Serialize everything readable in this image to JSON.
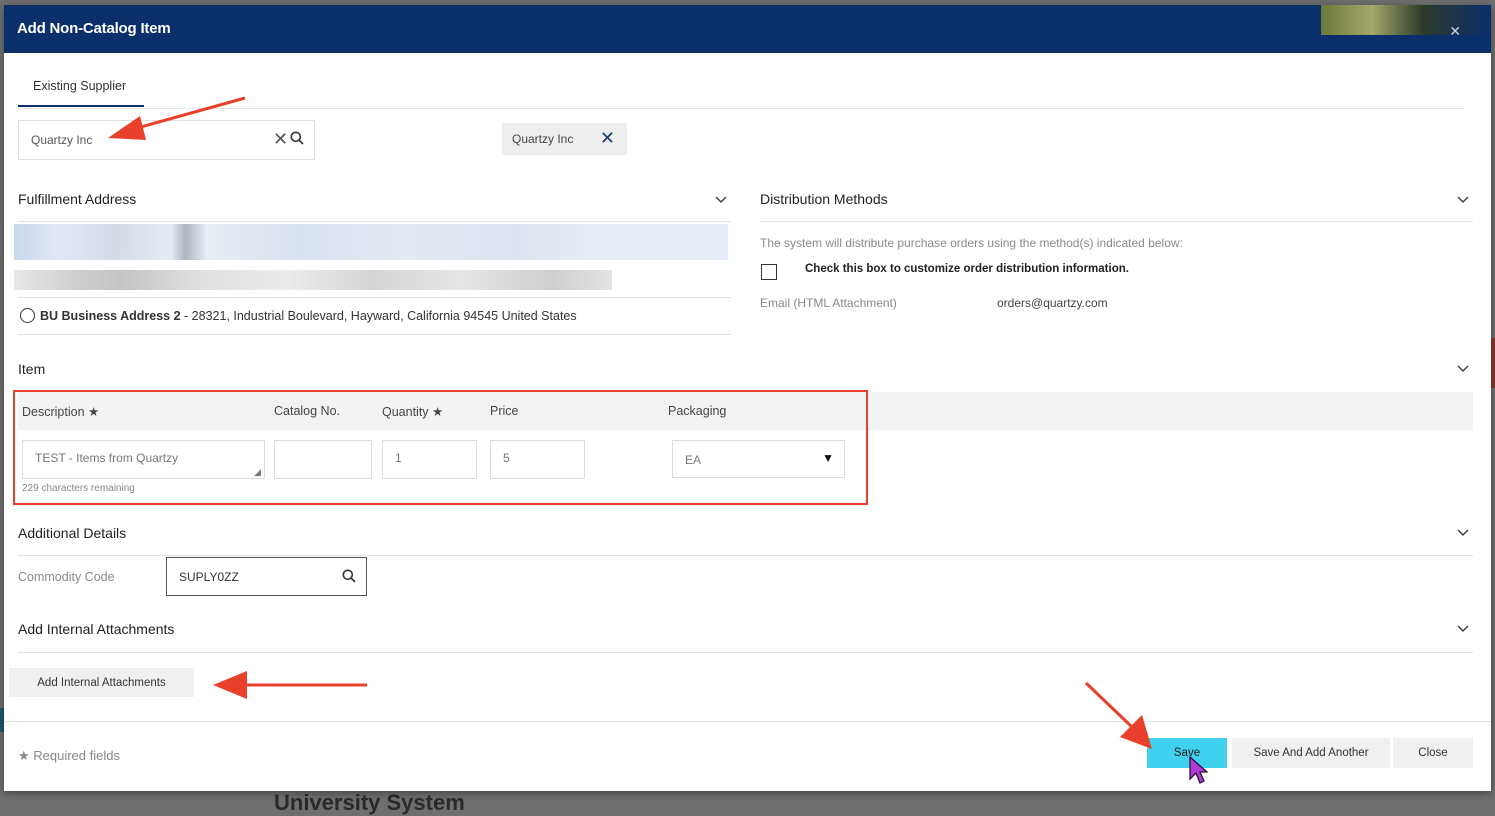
{
  "modal": {
    "title": "Add Non-Catalog Item"
  },
  "tabs": [
    {
      "label": "Existing Supplier"
    }
  ],
  "supplier_search": {
    "value": "Quartzy Inc",
    "selected_chip": "Quartzy Inc"
  },
  "fulfillment": {
    "title": "Fulfillment Address",
    "option_name": "BU Business Address 2",
    "option_address": " - 28321, Industrial Boulevard, Hayward, California 94545 United States"
  },
  "distribution": {
    "title": "Distribution Methods",
    "description": "The system will distribute purchase orders using the method(s) indicated below:",
    "checkbox_label": "Check this box to customize order distribution information.",
    "email_label": "Email (HTML Attachment)",
    "email_value": "orders@quartzy.com"
  },
  "item": {
    "title": "Item",
    "columns": {
      "description": "Description",
      "catalog_no": "Catalog No.",
      "quantity": "Quantity",
      "price": "Price",
      "packaging": "Packaging"
    },
    "required_marker": "★",
    "values": {
      "description": "TEST - Items from Quartzy",
      "catalog_no": "",
      "quantity": "1",
      "price": "5",
      "packaging": "EA"
    },
    "chars_remaining": "229 characters remaining"
  },
  "additional_details": {
    "title": "Additional Details",
    "commodity_label": "Commodity Code",
    "commodity_value": "SUPLY0ZZ"
  },
  "attachments": {
    "title": "Add Internal Attachments",
    "button_label": "Add Internal Attachments"
  },
  "footer": {
    "required_note": "★ Required fields",
    "save_label": "Save",
    "save_another_label": "Save And Add Another",
    "close_label": "Close"
  },
  "background": {
    "partial_title": "University System"
  },
  "colors": {
    "header": "#0b2f6b",
    "save_button": "#3fd1ee",
    "annotation": "#e8402a"
  }
}
